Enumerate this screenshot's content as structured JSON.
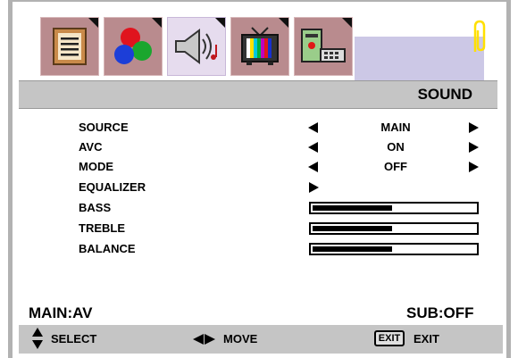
{
  "menu_title": "SOUND",
  "tabs": [
    {
      "name": "program-list-icon",
      "active": false
    },
    {
      "name": "color-balls-icon",
      "active": false
    },
    {
      "name": "speaker-icon",
      "active": true
    },
    {
      "name": "tv-icon",
      "active": false
    },
    {
      "name": "computer-icon",
      "active": false
    }
  ],
  "rows": [
    {
      "label": "SOURCE",
      "kind": "select",
      "value": "MAIN"
    },
    {
      "label": "AVC",
      "kind": "select",
      "value": "ON"
    },
    {
      "label": "MODE",
      "kind": "select",
      "value": "OFF"
    },
    {
      "label": "EQUALIZER",
      "kind": "submenu"
    },
    {
      "label": "BASS",
      "kind": "slider",
      "level": 0.5
    },
    {
      "label": "TREBLE",
      "kind": "slider",
      "level": 0.5
    },
    {
      "label": "BALANCE",
      "kind": "slider",
      "level": 0.5
    }
  ],
  "status": {
    "main": "MAIN:AV",
    "sub": "SUB:OFF"
  },
  "help": {
    "select_label": "SELECT",
    "move_label": "MOVE",
    "exit_key": "EXIT",
    "exit_label": "EXIT"
  },
  "colors": {
    "tab": "#b98b8e",
    "tab_active": "#e6dcee",
    "tab_strip": "#ccc8e6",
    "bar": "#c5c5c5",
    "accent_clip": "#ffe000"
  }
}
